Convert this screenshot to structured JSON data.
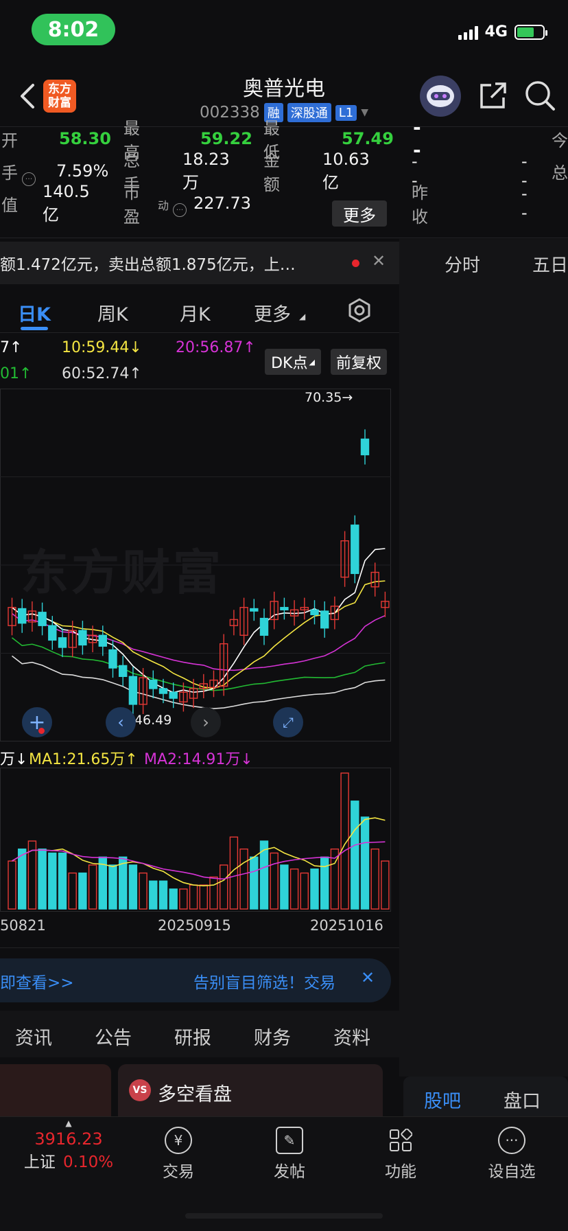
{
  "status_bar": {
    "time": "8:02",
    "network": "4G"
  },
  "header": {
    "title": "奥普光电",
    "code": "002338",
    "tags": [
      "融",
      "深股通",
      "L1"
    ],
    "logo_text": [
      "东方",
      "财富"
    ],
    "icons": [
      "back-icon",
      "share-icon",
      "search-icon"
    ]
  },
  "quote": {
    "row1": {
      "open_label": "开",
      "open": "58.30",
      "high_label": "最高",
      "high": "59.22",
      "low_label": "最低",
      "low": "57.49",
      "right_value": "- -",
      "right_label": "今"
    },
    "row2": {
      "turnover_label": "手",
      "turnover": "7.59%",
      "volume_label": "总手",
      "volume": "18.23万",
      "amount_label": "金额",
      "amount": "10.63亿",
      "right_a": "--",
      "right_b": "--",
      "right_label": "总"
    },
    "row3": {
      "mcap_label": "值",
      "mcap": "140.5亿",
      "pe_label": "市盈",
      "pe_sup": "动",
      "pe": "227.73",
      "more": "更多",
      "prev_close_label": "昨收",
      "prev_close": "--"
    }
  },
  "notice": {
    "text": "额1.472亿元，卖出总额1.875亿元，上…"
  },
  "right_tabs": [
    "分时",
    "五日"
  ],
  "period_tabs": {
    "items": [
      "日K",
      "周K",
      "月K",
      "更多"
    ],
    "active": 0
  },
  "ma": {
    "l1": "7↑",
    "l2": "10:59.44↓",
    "l3": "20:56.87↑",
    "l4": "01↑",
    "l5": "60:52.74↑",
    "dk": "DK点",
    "fq": "前复权"
  },
  "kline": {
    "high_label": "70.35→",
    "low_label": "←46.49",
    "watermark": "东方财富"
  },
  "volume_legend": {
    "v0": "万↓",
    "ma1": "MA1:21.65万↑",
    "ma2": "MA2:14.91万↓"
  },
  "dates": [
    "50821",
    "20250915",
    "20251016"
  ],
  "chart_data": {
    "type": "candlestick",
    "candles": [
      {
        "o": 53.0,
        "c": 54.5
      },
      {
        "o": 54.4,
        "c": 53.2
      },
      {
        "o": 53.3,
        "c": 54.2
      },
      {
        "o": 54.1,
        "c": 53.0
      },
      {
        "o": 53.0,
        "c": 51.8
      },
      {
        "o": 52.0,
        "c": 51.2
      },
      {
        "o": 51.2,
        "c": 52.6
      },
      {
        "o": 52.6,
        "c": 51.4
      },
      {
        "o": 51.6,
        "c": 52.2
      },
      {
        "o": 52.2,
        "c": 51.3
      },
      {
        "o": 51.0,
        "c": 49.5
      },
      {
        "o": 49.7,
        "c": 48.8
      },
      {
        "o": 48.8,
        "c": 46.5
      },
      {
        "o": 46.5,
        "c": 48.7
      },
      {
        "o": 48.5,
        "c": 47.8
      },
      {
        "o": 47.8,
        "c": 47.4
      },
      {
        "o": 47.5,
        "c": 47.0
      },
      {
        "o": 46.7,
        "c": 47.5
      },
      {
        "o": 47.0,
        "c": 47.8
      },
      {
        "o": 47.8,
        "c": 48.2
      },
      {
        "o": 47.9,
        "c": 48.5
      },
      {
        "o": 48.0,
        "c": 51.5
      },
      {
        "o": 53.0,
        "c": 53.5
      },
      {
        "o": 52.2,
        "c": 54.5
      },
      {
        "o": 54.4,
        "c": 54.2
      },
      {
        "o": 53.6,
        "c": 52.2
      },
      {
        "o": 53.5,
        "c": 55.0
      },
      {
        "o": 54.5,
        "c": 54.3
      },
      {
        "o": 53.8,
        "c": 54.3
      },
      {
        "o": 54.3,
        "c": 54.5
      },
      {
        "o": 54.3,
        "c": 53.9
      },
      {
        "o": 54.2,
        "c": 52.8
      },
      {
        "o": 53.5,
        "c": 54.6
      },
      {
        "o": 57.0,
        "c": 60.0
      },
      {
        "o": 61.3,
        "c": 57.3
      },
      {
        "o": 68.4,
        "c": 67.1
      },
      {
        "o": 56.2,
        "c": 57.4
      },
      {
        "o": 54.5,
        "c": 55.0
      }
    ],
    "volumes": [
      12,
      15,
      17,
      15,
      14,
      14,
      9,
      9,
      11,
      13,
      11,
      13,
      11,
      9,
      7,
      7,
      5,
      5,
      6,
      6,
      8,
      11,
      18,
      15,
      13,
      17,
      14,
      11,
      10,
      9,
      10,
      13,
      15,
      34,
      27,
      23,
      15,
      12
    ],
    "price_range": [
      44,
      72
    ],
    "colors": {
      "up": "#e53935",
      "down": "#2fd3d8",
      "ma5": "#ffffff",
      "ma10": "#f4e542",
      "ma20": "#d633d6",
      "ma30": "#22bb33",
      "ma60": "#dddddd"
    }
  },
  "banner": {
    "left": "即查看>>",
    "right": "告别盲目筛选！交易"
  },
  "info_tabs": [
    "资讯",
    "公告",
    "研报",
    "财务",
    "资料"
  ],
  "card": {
    "label": "多空看盘",
    "badge": "VS"
  },
  "right_bottom_tabs": [
    "股吧",
    "盘口"
  ],
  "bottom_nav": {
    "index_value": "3916.23",
    "index_name": "上证",
    "index_change": "0.10%",
    "items": [
      "交易",
      "发帖",
      "功能",
      "设自选"
    ]
  }
}
